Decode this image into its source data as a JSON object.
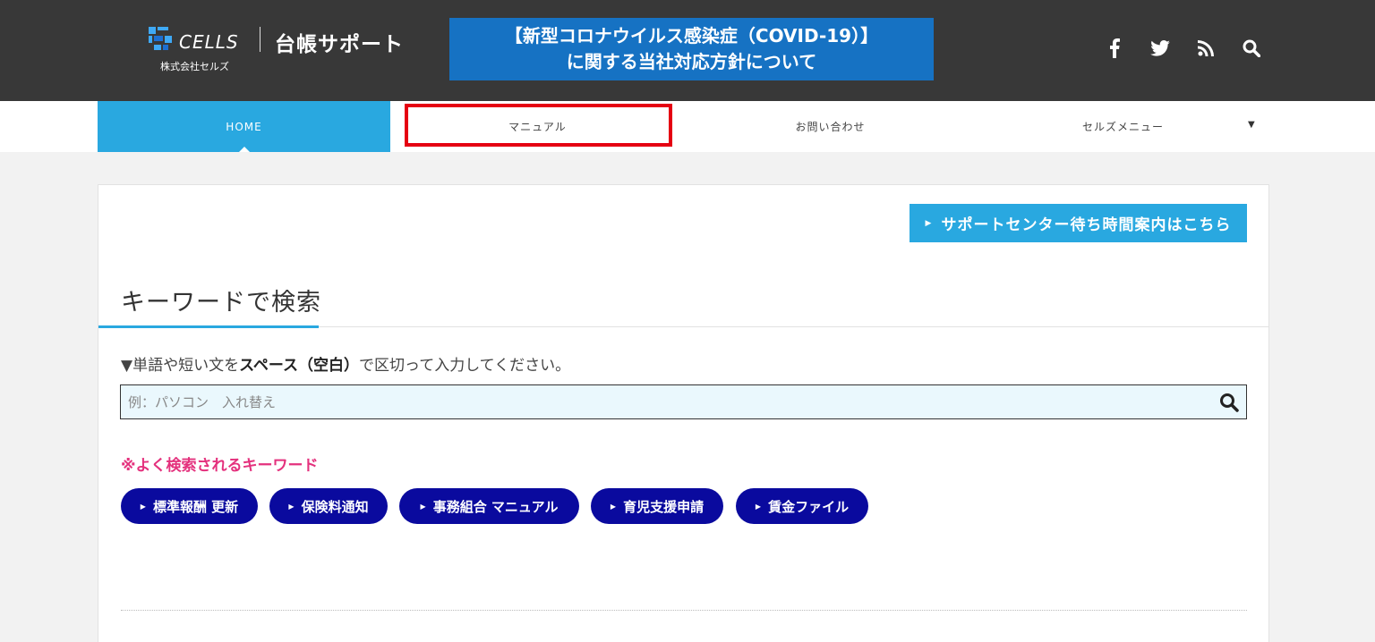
{
  "header": {
    "logo_text": "CELLS",
    "company": "株式会社セルズ",
    "site_title": "台帳サポート",
    "banner_line1": "【新型コロナウイルス感染症（COVID-19）】",
    "banner_line2": "に関する当社対応方針について",
    "social_icons": [
      "facebook-icon",
      "twitter-icon",
      "rss-icon",
      "search-icon"
    ]
  },
  "nav": {
    "items": [
      {
        "label": "HOME",
        "active": true
      },
      {
        "label": "マニュアル",
        "active": false
      },
      {
        "label": "お問い合わせ",
        "active": false
      },
      {
        "label": "セルズメニュー",
        "active": false
      }
    ],
    "dropdown_arrow": "▼"
  },
  "main": {
    "support_button": "サポートセンター待ち時間案内はこちら",
    "section_title": "キーワードで検索",
    "instruction_pre": "▼単語や短い文を",
    "instruction_bold": "スペース（空白）",
    "instruction_post": "で区切って入力してください。",
    "search_placeholder": "例：パソコン　入れ替え",
    "keywords_title": "※よく検索されるキーワード",
    "tags": [
      "標準報酬 更新",
      "保険料通知",
      "事務組合 マニュアル",
      "育児支援申請",
      "賃金ファイル"
    ]
  },
  "colors": {
    "header_bg": "#383838",
    "banner_bg": "#1672c3",
    "accent": "#29a8e0",
    "tag_bg": "#0a0a9e",
    "keyword_title": "#e4317d",
    "highlight": "#e50012"
  }
}
